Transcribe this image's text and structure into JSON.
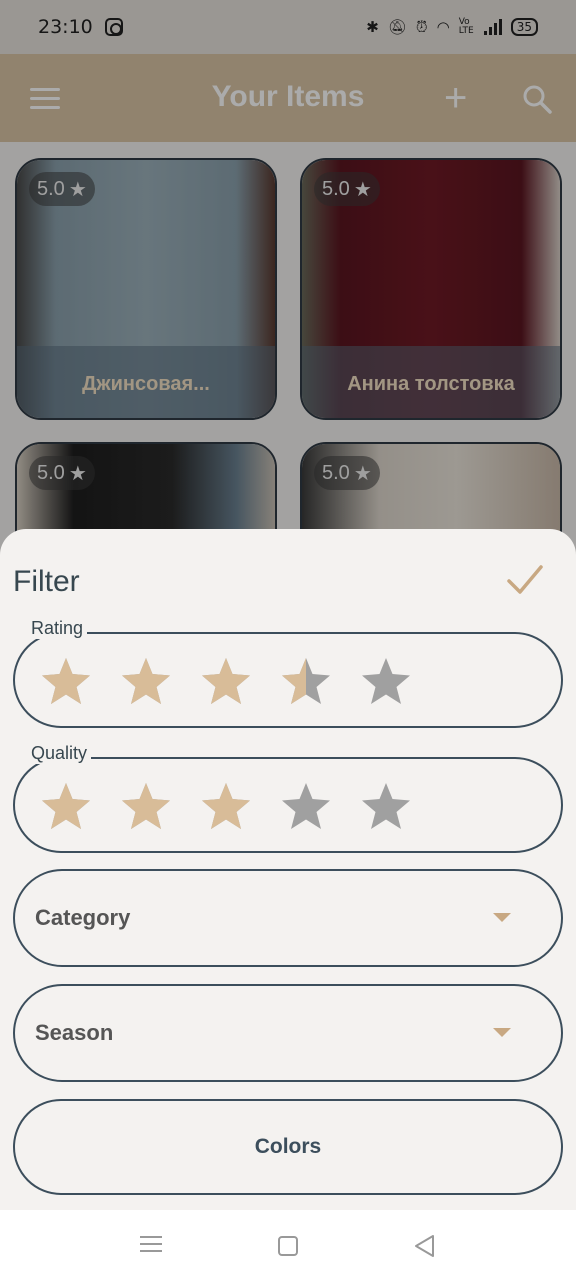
{
  "status_bar": {
    "time": "23:10",
    "battery": "35",
    "volte": "Vo LTE"
  },
  "app_bar": {
    "title": "Your Items",
    "menu_icon": "menu-icon",
    "add_icon": "plus-icon",
    "search_icon": "search-icon"
  },
  "items": [
    {
      "rating": "5.0",
      "name": "Джинсовая...",
      "color": "#8aa0ac"
    },
    {
      "rating": "5.0",
      "name": "Анина толстовка",
      "color": "#6e1a24"
    },
    {
      "rating": "5.0",
      "name": "",
      "color": "#1e1e1e"
    },
    {
      "rating": "5.0",
      "name": "",
      "color": "#d6cec2"
    }
  ],
  "filter": {
    "title": "Filter",
    "confirm_icon": "check-icon",
    "rating": {
      "label": "Rating",
      "value": 3.5,
      "max": 5
    },
    "quality": {
      "label": "Quality",
      "value": 3,
      "max": 5
    },
    "category": {
      "label": "Category"
    },
    "season": {
      "label": "Season"
    },
    "colors": {
      "label": "Colors"
    }
  },
  "colors": {
    "accent": "#d8c4a4",
    "star_on": "#d8bc98",
    "star_off": "#a0a0a0",
    "outline": "#3c4e5c"
  }
}
